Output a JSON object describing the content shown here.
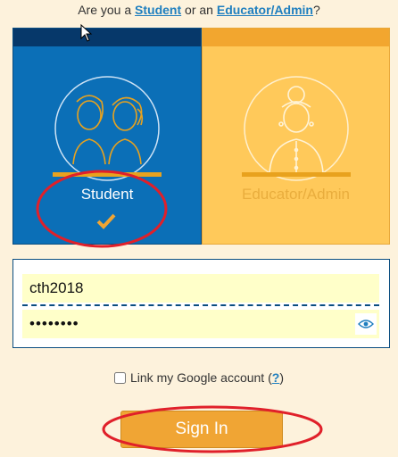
{
  "question": {
    "prefix": "Are you a ",
    "student_link": "Student",
    "middle": " or an ",
    "educator_link": "Educator/Admin",
    "suffix": "?"
  },
  "roles": {
    "student": {
      "label": "Student",
      "selected": true
    },
    "educator": {
      "label": "Educator/Admin",
      "selected": false
    }
  },
  "login": {
    "username_value": "cth2018",
    "password_value": "••••••••"
  },
  "google": {
    "label": "Link my Google account (",
    "help": "?",
    "close": ")"
  },
  "signin_label": "Sign In",
  "colors": {
    "student_card": "#0b6fb7",
    "educator_card": "#ffc95a",
    "accent": "#f0a534",
    "annotation": "#e0202a"
  }
}
